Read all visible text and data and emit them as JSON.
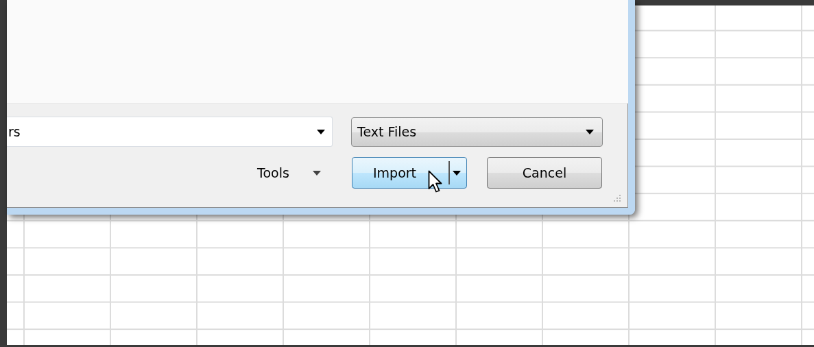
{
  "file_name": {
    "value": "rs"
  },
  "file_type": {
    "value": "Text Files"
  },
  "tools": {
    "label": "Tools"
  },
  "buttons": [
    {
      "kind": "split",
      "label": "Import",
      "hovered": true
    },
    {
      "kind": "plain",
      "label": "Cancel",
      "hovered": false
    }
  ]
}
